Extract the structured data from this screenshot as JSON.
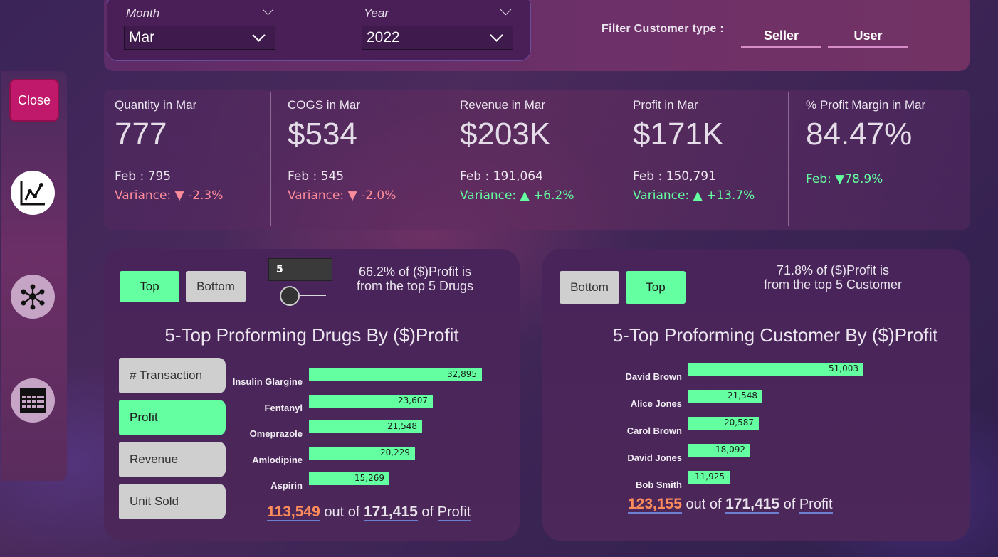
{
  "close_label": "Close",
  "filters": {
    "month": {
      "label": "Month",
      "value": "Mar"
    },
    "year": {
      "label": "Year",
      "value": "2022"
    },
    "customer_type_label": "Filter Customer type :",
    "customer_types": [
      "Seller",
      "User"
    ]
  },
  "kpis": [
    {
      "title": "Quantity in Mar",
      "value": "777",
      "prev": "Feb : 795",
      "variance_label": "Variance:",
      "variance_arrow": "▼",
      "variance": "-2.3%",
      "trend": "down"
    },
    {
      "title": "COGS in Mar",
      "value": "$534",
      "prev": "Feb : 545",
      "variance_label": "Variance:",
      "variance_arrow": "▼",
      "variance": "-2.0%",
      "trend": "down"
    },
    {
      "title": "Revenue in Mar",
      "value": "$203K",
      "prev": "Feb : 191,064",
      "variance_label": "Variance:",
      "variance_arrow": "▲",
      "variance": "+6.2%",
      "trend": "up"
    },
    {
      "title": "Profit in Mar",
      "value": "$171K",
      "prev": "Feb : 150,791",
      "variance_label": "Variance:",
      "variance_arrow": "▲",
      "variance": "+13.7%",
      "trend": "up"
    },
    {
      "title": "% Profit Margin in Mar",
      "value": "84.47%",
      "prev": "Feb:",
      "variance_arrow": "▼",
      "variance": "78.9%",
      "trend": "up"
    }
  ],
  "drugs_panel": {
    "top_label": "Top",
    "bottom_label": "Bottom",
    "n_value": "5",
    "slider_fraction": 0.0,
    "note_line1": "66.2% of ($)Profit is",
    "note_line2": "from the top 5 Drugs",
    "title": "5-Top Proforming Drugs By ($)Profit",
    "metric_buttons": [
      "# Transaction",
      "Profit",
      "Revenue",
      "Unit Sold"
    ],
    "selected_metric": "Profit",
    "summary": {
      "part": "113,549",
      "out_of": "out of",
      "total": "171,415",
      "of": "of",
      "metric": "Profit"
    }
  },
  "customers_panel": {
    "bottom_label": "Bottom",
    "top_label": "Top",
    "note_line1": "71.8% of ($)Profit is",
    "note_line2": "from the top 5 Customer",
    "title": "5-Top Proforming Customer By ($)Profit",
    "summary": {
      "part": "123,155",
      "out_of": "out of",
      "total": "171,415",
      "of": "of",
      "metric": "Profit"
    }
  },
  "chart_data": [
    {
      "type": "bar",
      "orientation": "horizontal",
      "categories": [
        "Insulin Glargine",
        "Fentanyl",
        "Omeprazole",
        "Amlodipine",
        "Aspirin"
      ],
      "values": [
        32895,
        23607,
        21548,
        20229,
        15269
      ],
      "value_labels": [
        "32,895",
        "23,607",
        "21,548",
        "20,229",
        "15,269"
      ],
      "color": "#63ffa0"
    },
    {
      "type": "bar",
      "orientation": "horizontal",
      "categories": [
        "David Brown",
        "Alice Jones",
        "Carol Brown",
        "David Jones",
        "Bob Smith"
      ],
      "values": [
        51003,
        21548,
        20587,
        18092,
        11925
      ],
      "value_labels": [
        "51,003",
        "21,548",
        "20,587",
        "18,092",
        "11,925"
      ],
      "color": "#63ffa0"
    }
  ]
}
